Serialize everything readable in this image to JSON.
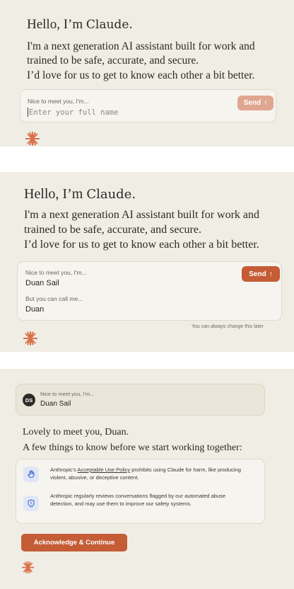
{
  "brand": {
    "accent": "#c45c36",
    "accent_disabled": "#e0a690",
    "background": "#f0ede5"
  },
  "step1": {
    "greeting_prefix": "Hello, I’m",
    "greeting_name": "Claude.",
    "intro": "I'm a next generation AI assistant built for work and trained to be safe, accurate, and secure.",
    "intro2": "I’d love for us to get to know each other a bit better.",
    "name_label": "Nice to meet you, I'm...",
    "name_placeholder": "Enter your full name",
    "send_label": "Send",
    "send_icon": "arrow-up-icon"
  },
  "step2": {
    "greeting_prefix": "Hello, I’m",
    "greeting_name": "Claude.",
    "intro": "I'm a next generation AI assistant built for work and trained to be safe, accurate, and secure.",
    "intro2": "I’d love for us to get to know each other a bit better.",
    "name_label": "Nice to meet you, I'm...",
    "name_value": "Duan Sail",
    "nickname_label": "But you can call me...",
    "nickname_value": "Duan",
    "send_label": "Send",
    "hint": "You can always change this later"
  },
  "step3": {
    "avatar_initials": "DS",
    "msg_label": "Nice to meet you, I'm...",
    "msg_value": "Duan Sail",
    "reply1": "Lovely to meet you, Duan.",
    "reply2": "A few things to know before we start working together:",
    "notice1_prefix": "Anthropic's",
    "notice1_link": "Acceptable Use Policy",
    "notice1_suffix": "prohibits using Claude for harm, like producing violent, abusive, or deceptive content.",
    "notice1_icon": "hand-stop-icon",
    "notice2": "Anthropic regularly reviews conversations flagged by our automated abuse detection, and may use them to improve our safety systems.",
    "notice2_icon": "shield-alert-icon",
    "ack_label": "Acknowledge & Continue"
  }
}
